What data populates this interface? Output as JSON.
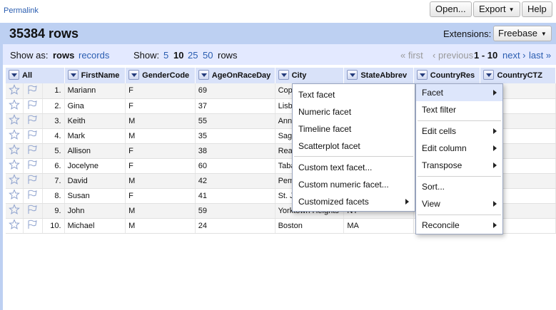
{
  "topbar": {
    "permalink": "Permalink",
    "open_label": "Open...",
    "export_label": "Export",
    "help_label": "Help"
  },
  "header": {
    "rows_title": "35384 rows",
    "extensions_label": "Extensions:",
    "extensions_button": "Freebase"
  },
  "controls": {
    "show_as_label": "Show as:",
    "rows_mode": "rows",
    "records_mode": "records",
    "show_label": "Show:",
    "page_sizes": [
      "5",
      "10",
      "25",
      "50"
    ],
    "selected_page_size": "10",
    "rows_word": "rows",
    "first": "« first",
    "previous": "‹ previous",
    "range": "1 - 10",
    "next": "next ›",
    "last": "last »"
  },
  "grid": {
    "all_label": "All",
    "columns": [
      "FirstName",
      "GenderCode",
      "AgeOnRaceDay",
      "City",
      "StateAbbrev",
      "CountryRes",
      "CountryCTZ"
    ],
    "rows": [
      {
        "idx": "1.",
        "first": "Mariann",
        "gender": "F",
        "age": "69",
        "city": "Cop",
        "state": ""
      },
      {
        "idx": "2.",
        "first": "Gina",
        "gender": "F",
        "age": "37",
        "city": "Lisb",
        "state": ""
      },
      {
        "idx": "3.",
        "first": "Keith",
        "gender": "M",
        "age": "55",
        "city": "Ann",
        "state": ""
      },
      {
        "idx": "4.",
        "first": "Mark",
        "gender": "M",
        "age": "35",
        "city": "Saga",
        "state": ""
      },
      {
        "idx": "5.",
        "first": "Allison",
        "gender": "F",
        "age": "38",
        "city": "Rea",
        "state": ""
      },
      {
        "idx": "6.",
        "first": "Jocelyne",
        "gender": "F",
        "age": "60",
        "city": "Taba",
        "state": ""
      },
      {
        "idx": "7.",
        "first": "David",
        "gender": "M",
        "age": "42",
        "city": "Pem",
        "state": ""
      },
      {
        "idx": "8.",
        "first": "Susan",
        "gender": "F",
        "age": "41",
        "city": "St. J",
        "state": ""
      },
      {
        "idx": "9.",
        "first": "John",
        "gender": "M",
        "age": "59",
        "city": "Yorktown Heights",
        "state": "NY"
      },
      {
        "idx": "10.",
        "first": "Michael",
        "gender": "M",
        "age": "24",
        "city": "Boston",
        "state": "MA"
      }
    ]
  },
  "column_menu": {
    "facet": "Facet",
    "text_filter": "Text filter",
    "edit_cells": "Edit cells",
    "edit_column": "Edit column",
    "transpose": "Transpose",
    "sort": "Sort...",
    "view": "View",
    "reconcile": "Reconcile"
  },
  "facet_submenu": {
    "text_facet": "Text facet",
    "numeric_facet": "Numeric facet",
    "timeline_facet": "Timeline facet",
    "scatterplot_facet": "Scatterplot facet",
    "custom_text_facet": "Custom text facet...",
    "custom_numeric_facet": "Custom numeric facet...",
    "customized_facets": "Customized facets"
  },
  "colors": {
    "header_band": "#bdd0f2",
    "controls_band": "#e3e9ff",
    "link": "#2a5db0",
    "column_header": "#d9e2f9",
    "menu_highlight": "#dde6fb"
  }
}
